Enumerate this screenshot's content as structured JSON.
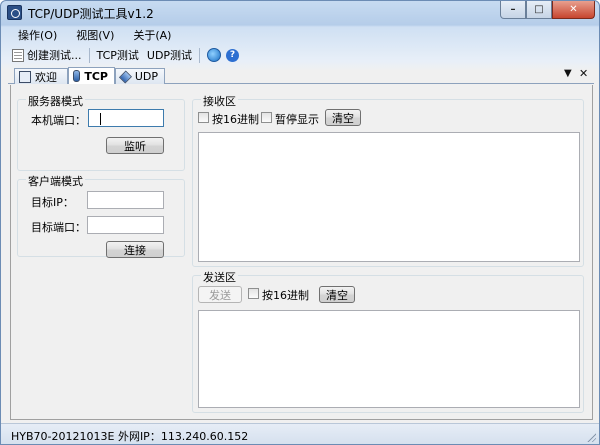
{
  "window": {
    "title": "TCP/UDP测试工具v1.2"
  },
  "menu": {
    "items": [
      "操作(O)",
      "视图(V)",
      "关于(A)"
    ]
  },
  "toolbar": {
    "create_label": "创建测试...",
    "tcp_label": "TCP测试",
    "udp_label": "UDP测试"
  },
  "tabs": [
    {
      "label": "欢迎",
      "icon": "welcome-icon",
      "active": false
    },
    {
      "label": "TCP",
      "icon": "tcp-icon",
      "active": true
    },
    {
      "label": "UDP",
      "icon": "udp-icon",
      "active": false
    }
  ],
  "server": {
    "title": "服务器模式",
    "port_label": "本机端口：",
    "port_value": "",
    "listen_label": "监听"
  },
  "client": {
    "title": "客户端模式",
    "ip_label": "目标IP：",
    "ip_value": "",
    "port_label": "目标端口：",
    "port_value": "",
    "connect_label": "连接"
  },
  "receive": {
    "title": "接收区",
    "hex_label": "按16进制",
    "pause_label": "暂停显示",
    "clear_label": "清空",
    "content": ""
  },
  "send": {
    "title": "发送区",
    "send_label": "发送",
    "hex_label": "按16进制",
    "clear_label": "清空",
    "content": ""
  },
  "status": {
    "text": "HYB70-20121013E  外网IP：113.240.60.152"
  }
}
